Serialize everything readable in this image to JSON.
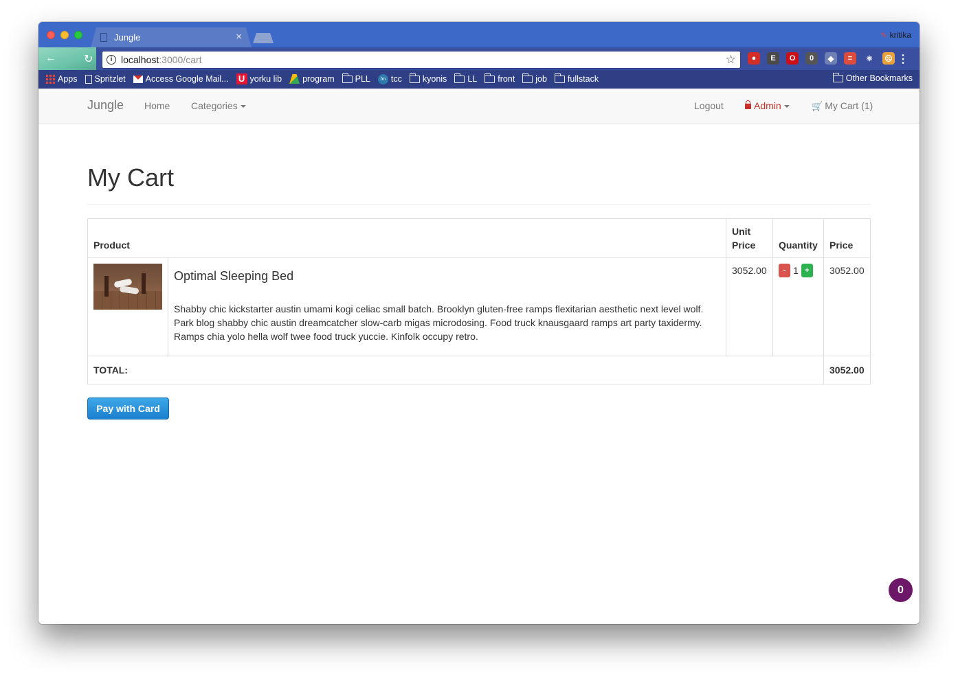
{
  "browser": {
    "tab_title": "Jungle",
    "tab_close": "×",
    "profile_name": "kritika",
    "url_host": "localhost",
    "url_path": ":3000/cart",
    "info_icon": "i",
    "star_icon": "☆",
    "menu_icon": "⋮",
    "back_icon": "←",
    "reload_icon": "↻",
    "extensions": [
      {
        "name": "lastpass-icon",
        "color": "#d32d27",
        "glyph": "●"
      },
      {
        "name": "evernote-icon",
        "color": "#4a4a4a",
        "glyph": "E"
      },
      {
        "name": "opera-icon",
        "color": "#cc0f16",
        "glyph": "O"
      },
      {
        "name": "extension-badge-icon",
        "color": "#555555",
        "glyph": "0"
      },
      {
        "name": "dropbox-icon",
        "color": "#6e7fb3",
        "glyph": "◆"
      },
      {
        "name": "todoist-icon",
        "color": "#db4c3f",
        "glyph": "≡"
      },
      {
        "name": "react-icon",
        "color": "#3b4fa0",
        "glyph": "⚛"
      },
      {
        "name": "face-icon",
        "color": "#e9a23b",
        "glyph": "☹"
      }
    ]
  },
  "bookmarks": {
    "items": [
      {
        "label": "Apps",
        "icon": "apps"
      },
      {
        "label": "Spritzlet",
        "icon": "page"
      },
      {
        "label": "Access Google Mail...",
        "icon": "gmail"
      },
      {
        "label": "yorku lib",
        "icon": "york"
      },
      {
        "label": "program",
        "icon": "drive"
      },
      {
        "label": "PLL",
        "icon": "folder"
      },
      {
        "label": "tcc",
        "icon": "hn"
      },
      {
        "label": "kyonis",
        "icon": "folder"
      },
      {
        "label": "LL",
        "icon": "folder"
      },
      {
        "label": "front",
        "icon": "folder"
      },
      {
        "label": "job",
        "icon": "folder"
      },
      {
        "label": "fullstack",
        "icon": "folder"
      }
    ],
    "other": "Other Bookmarks",
    "york_glyph": "U",
    "hn_glyph": "hn"
  },
  "navbar": {
    "brand": "Jungle",
    "home": "Home",
    "categories": "Categories",
    "logout": "Logout",
    "admin": "Admin",
    "cart": "My Cart (1)",
    "cart_icon": "🛒"
  },
  "page": {
    "title": "My Cart",
    "table": {
      "headers": {
        "product": "Product",
        "unit_price": "Unit Price",
        "quantity": "Quantity",
        "price": "Price"
      },
      "rows": [
        {
          "name": "Optimal Sleeping Bed",
          "description": "Shabby chic kickstarter austin umami kogi celiac small batch. Brooklyn gluten-free ramps flexitarian aesthetic next level wolf. Park blog shabby chic austin dreamcatcher slow-carb migas microdosing. Food truck knausgaard ramps art party taxidermy. Ramps chia yolo hella wolf twee food truck yuccie. Kinfolk occupy retro.",
          "unit_price": "3052.00",
          "quantity": "1",
          "price": "3052.00"
        }
      ],
      "minus": "-",
      "plus": "+",
      "total_label": "TOTAL:",
      "total_value": "3052.00"
    },
    "pay_button": "Pay with Card"
  },
  "widget": {
    "count": "0"
  }
}
